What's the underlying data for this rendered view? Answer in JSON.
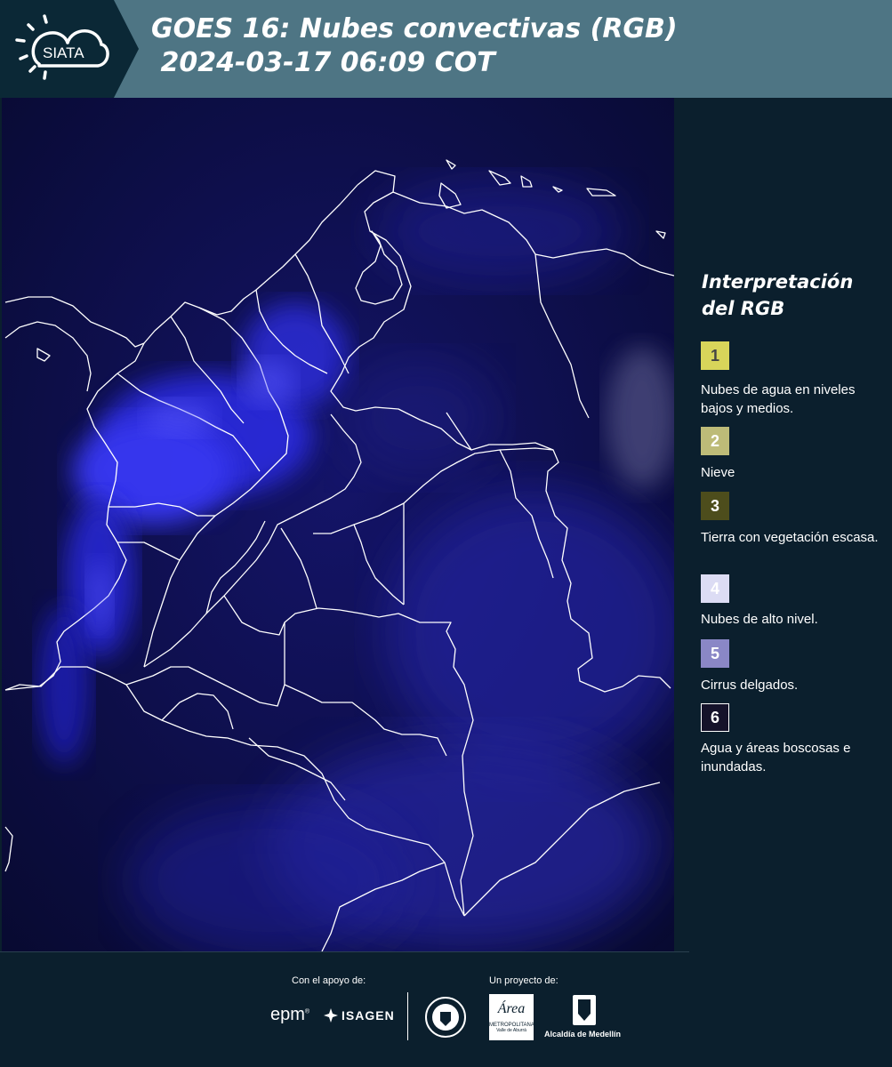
{
  "header": {
    "title_line1": "GOES 16: Nubes convectivas (RGB)",
    "title_line2": " 2024-03-17 06:09 COT",
    "logo_text": "SIATA"
  },
  "legend": {
    "title": "Interpretación del RGB",
    "items": [
      {
        "number": "1",
        "label": "Nubes de agua en niveles bajos y medios.",
        "color": "#d8d55a",
        "text_color": "#444444"
      },
      {
        "number": "2",
        "label": "Nieve",
        "color": "#bdbb78",
        "text_color": "#ffffff"
      },
      {
        "number": "3",
        "label": "Tierra con vegetación escasa.",
        "color": "#4d4d1c",
        "text_color": "#ffffff"
      },
      {
        "number": "4",
        "label": "Nubes de alto nivel.",
        "color": "#dcdcf4",
        "text_color": "#ffffff"
      },
      {
        "number": "5",
        "label": "Cirrus delgados.",
        "color": "#8a87c6",
        "text_color": "#ffffff"
      },
      {
        "number": "6",
        "label": "Agua y áreas boscosas e inundadas.",
        "color": "#15122a",
        "text_color": "#ffffff"
      }
    ]
  },
  "footer": {
    "support_label": "Con el apoyo de:",
    "project_label": "Un proyecto de:",
    "epm": "epm",
    "isagen": "ISAGEN",
    "area_top": "Área",
    "area_bottom1": "METROPOLITANA",
    "area_bottom2": "Valle de Aburrá",
    "alcaldia": "Alcaldía de Medellín"
  },
  "colors": {
    "header_bg": "#4e7584",
    "logo_band": "#0b2836",
    "panel_bg": "#0b1f2d",
    "map_bg": "#0a0d3a",
    "cloud_blue": "#3d3dff"
  }
}
